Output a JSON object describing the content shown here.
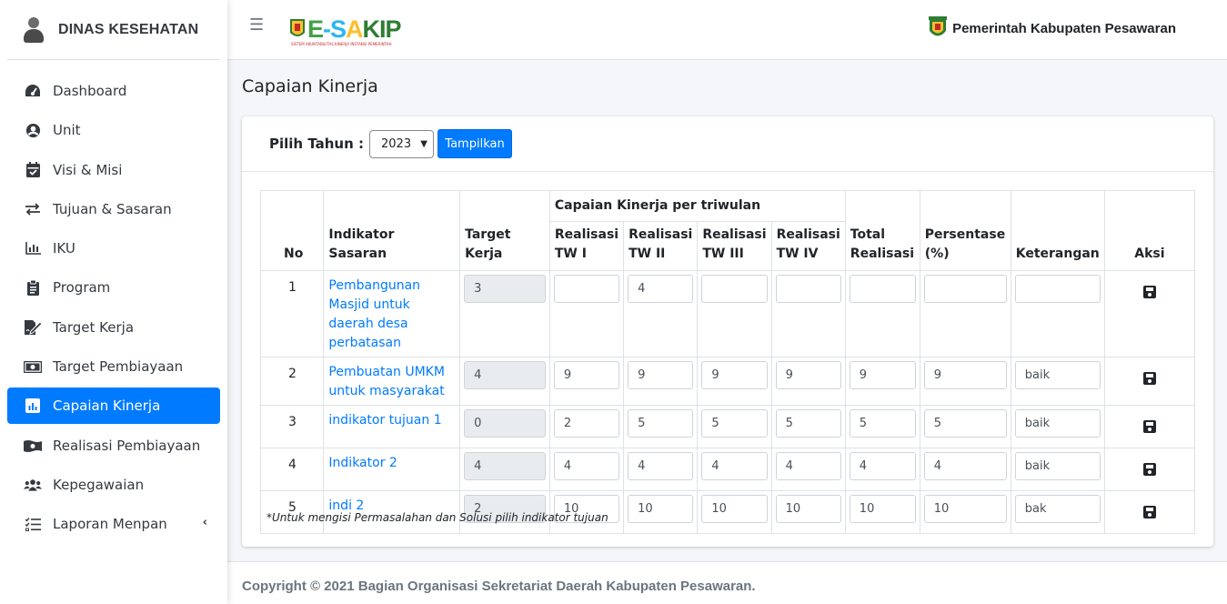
{
  "sidebar": {
    "brand": "DINAS KESEHATAN",
    "items": [
      {
        "label": "Dashboard",
        "icon": "tachometer-icon"
      },
      {
        "label": "Unit",
        "icon": "user-circle-icon"
      },
      {
        "label": "Visi & Misi",
        "icon": "calendar-check-icon"
      },
      {
        "label": "Tujuan & Sasaran",
        "icon": "exchange-icon"
      },
      {
        "label": "IKU",
        "icon": "bar-chart-icon"
      },
      {
        "label": "Program",
        "icon": "clipboard-icon"
      },
      {
        "label": "Target Kerja",
        "icon": "file-signature-icon"
      },
      {
        "label": "Target Pembiayaan",
        "icon": "money-bill-icon"
      },
      {
        "label": "Capaian Kinerja",
        "icon": "chart-bar-icon",
        "active": true
      },
      {
        "label": "Realisasi Pembiayaan",
        "icon": "money-bill-wave-icon"
      },
      {
        "label": "Kepegawaian",
        "icon": "users-icon"
      },
      {
        "label": "Laporan Menpan",
        "icon": "list-check-icon"
      }
    ]
  },
  "header": {
    "logo_text": "E-SAKIP",
    "logo_sub": "SISTEM AKUNTABILITAS KINERJA INSTANSI PEMERINTAH",
    "pemkab": "Pemerintah Kabupaten Pesawaran"
  },
  "page": {
    "title": "Capaian Kinerja",
    "pilih_label": "Pilih Tahun :",
    "year": "2023",
    "button": "Tampilkan",
    "note": "*Untuk mengisi Permasalahan dan Solusi pilih indikator tujuan"
  },
  "table": {
    "headers": {
      "no": "No",
      "indikator": "Indikator Sasaran",
      "target": "Target Kerja",
      "group": "Capaian Kinerja per triwulan",
      "tw1": "Realisasi TW I",
      "tw2": "Realisasi TW II",
      "tw3": "Realisasi TW III",
      "tw4": "Realisasi TW IV",
      "total": "Total Realisasi",
      "persen": "Persentase (%)",
      "ket": "Keterangan",
      "aksi": "Aksi"
    },
    "rows": [
      {
        "no": "1",
        "indikator": "Pembangunan Masjid untuk daerah desa perbatasan",
        "target": "3",
        "tw1": "",
        "tw2": "4",
        "tw3": "",
        "tw4": "",
        "total": "",
        "persen": "",
        "ket": ""
      },
      {
        "no": "2",
        "indikator": "Pembuatan UMKM untuk masyarakat",
        "target": "4",
        "tw1": "9",
        "tw2": "9",
        "tw3": "9",
        "tw4": "9",
        "total": "9",
        "persen": "9",
        "ket": "baik"
      },
      {
        "no": "3",
        "indikator": "indikator tujuan 1",
        "target": "0",
        "tw1": "2",
        "tw2": "5",
        "tw3": "5",
        "tw4": "5",
        "total": "5",
        "persen": "5",
        "ket": "baik"
      },
      {
        "no": "4",
        "indikator": "Indikator 2",
        "target": "4",
        "tw1": "4",
        "tw2": "4",
        "tw3": "4",
        "tw4": "4",
        "total": "4",
        "persen": "4",
        "ket": "baik"
      },
      {
        "no": "5",
        "indikator": "indi 2",
        "target": "2",
        "tw1": "10",
        "tw2": "10",
        "tw3": "10",
        "tw4": "10",
        "total": "10",
        "persen": "10",
        "ket": "bak"
      }
    ]
  },
  "footer": {
    "text": "Copyright © 2021 Bagian Organisasi Sekretariat Daerah Kabupaten Pesawaran."
  },
  "colors": {
    "accent": "#007bff",
    "readonly": "#e9ecef"
  }
}
